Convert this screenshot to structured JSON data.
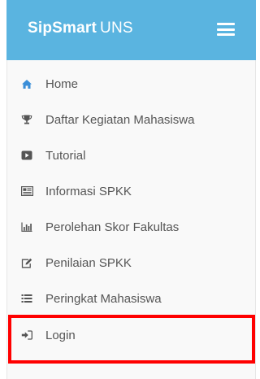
{
  "brand": {
    "part1": "Sip",
    "part2": "Smart",
    "part3": "UNS"
  },
  "colors": {
    "header_bg": "#5ab4e0",
    "sidebar_bg": "#f9f9f9",
    "text": "#555555",
    "highlight": "#ff0000",
    "home_icon": "#3a8ed8"
  },
  "menu": {
    "items": [
      {
        "label": "Home",
        "icon": "home-icon"
      },
      {
        "label": "Daftar Kegiatan Mahasiswa",
        "icon": "trophy-icon"
      },
      {
        "label": "Tutorial",
        "icon": "play-icon"
      },
      {
        "label": "Informasi SPKK",
        "icon": "newspaper-icon"
      },
      {
        "label": "Perolehan Skor Fakultas",
        "icon": "bar-chart-icon"
      },
      {
        "label": "Penilaian SPKK",
        "icon": "edit-icon"
      },
      {
        "label": "Peringkat Mahasiswa",
        "icon": "list-icon"
      },
      {
        "label": "Login",
        "icon": "sign-in-icon"
      }
    ]
  }
}
